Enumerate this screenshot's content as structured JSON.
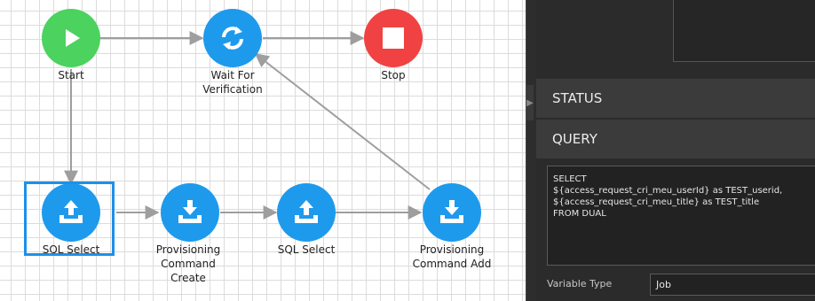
{
  "colors": {
    "start": "#4cd25f",
    "stop": "#f04242",
    "task": "#1e9aed",
    "edge": "#9e9e9e",
    "selection": "#1e90e8"
  },
  "workflow": {
    "nodes": {
      "start": {
        "label": "Start",
        "icon": "play-icon"
      },
      "wait": {
        "label": "Wait For Verification",
        "icon": "refresh-icon"
      },
      "stop": {
        "label": "Stop",
        "icon": "stop-icon"
      },
      "sql1": {
        "label": "SQL Select",
        "icon": "upload-icon"
      },
      "prov1": {
        "label": "Provisioning Command Create",
        "icon": "download-icon"
      },
      "sql2": {
        "label": "SQL Select",
        "icon": "upload-icon"
      },
      "prov2": {
        "label": "Provisioning Command Add",
        "icon": "download-icon"
      }
    }
  },
  "panel": {
    "status_header": "STATUS",
    "query_header": "QUERY",
    "query_text": "SELECT\n${access_request_cri_meu_userId} as TEST_userid,\n${access_request_cri_meu_title} as TEST_title\nFROM DUAL",
    "variable_type_label": "Variable Type",
    "variable_type_value": "Job"
  }
}
